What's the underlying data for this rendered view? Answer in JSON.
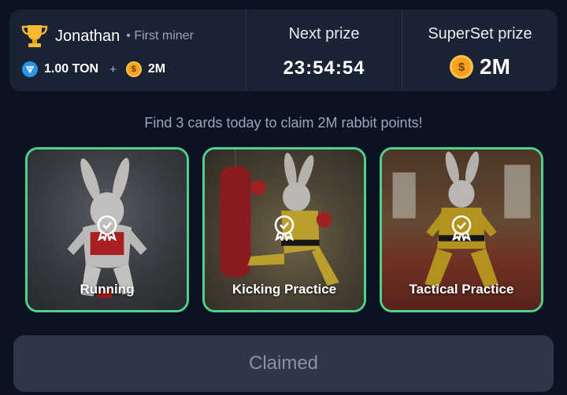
{
  "winner": {
    "name": "Jonathan",
    "tag": "• First miner",
    "reward_ton": "1.00 TON",
    "plus": "+",
    "reward_points": "2M"
  },
  "next_prize": {
    "label": "Next prize",
    "countdown": "23:54:54"
  },
  "superset": {
    "label": "SuperSet prize",
    "amount": "2M"
  },
  "instruction": "Find 3 cards today to claim 2M rabbit points!",
  "cards": [
    {
      "label": "Running"
    },
    {
      "label": "Kicking Practice"
    },
    {
      "label": "Tactical Practice"
    }
  ],
  "claim_button": "Claimed",
  "colors": {
    "background": "#0b1322",
    "panel": "#1a2333",
    "card_border": "#4fd18d",
    "button": "#2d3749",
    "coin": "#f4a221",
    "ton": "#2a94e6"
  }
}
